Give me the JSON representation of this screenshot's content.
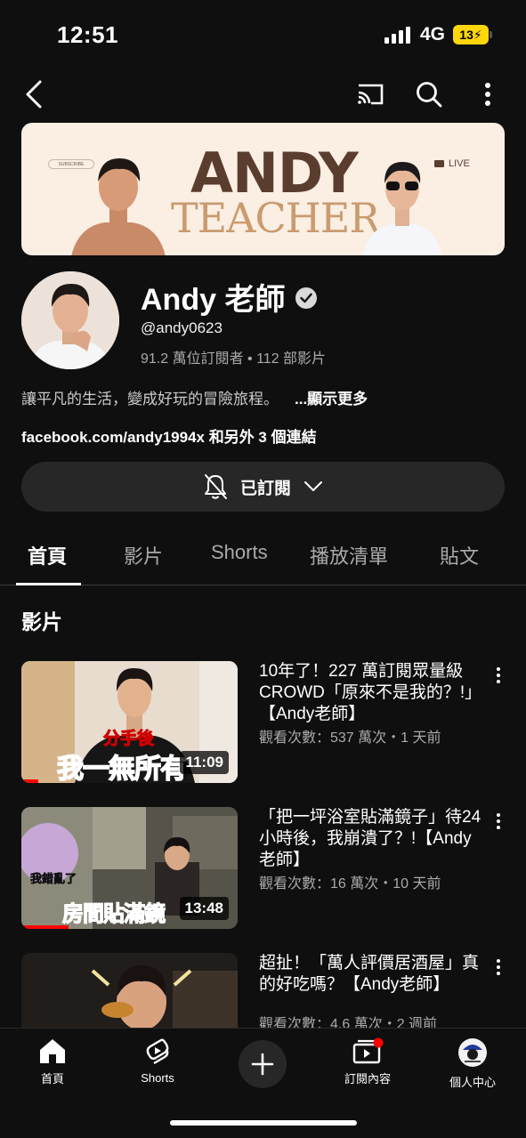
{
  "status_bar": {
    "time": "12:51",
    "network": "4G",
    "battery": "13"
  },
  "banner": {
    "title": "ANDY",
    "subtitle": "TEACHER",
    "live_label": "LIVE",
    "subscribe_label": "SUBSCRIBE"
  },
  "channel": {
    "name": "Andy 老師",
    "handle": "@andy0623",
    "stats": "91.2 萬位訂閱者 • 112 部影片",
    "description": "讓平凡的生活，變成好玩的冒險旅程。",
    "more_label": "...顯示更多",
    "links": "facebook.com/andy1994x 和另外 3 個連結",
    "subscribed_label": "已訂閱"
  },
  "tabs": [
    {
      "label": "首頁",
      "active": true
    },
    {
      "label": "影片",
      "active": false
    },
    {
      "label": "Shorts",
      "active": false
    },
    {
      "label": "播放清單",
      "active": false
    },
    {
      "label": "貼文",
      "active": false
    }
  ],
  "section_title": "影片",
  "videos": [
    {
      "title": "10年了！227 萬訂閱眾量級CROWD「原來不是我的？!」【Andy老師】",
      "meta": "觀看次數：537 萬次・1 天前",
      "duration": "11:09",
      "progress": 0.08,
      "thumb_caption_small": "分手後",
      "thumb_caption": "我一無所有"
    },
    {
      "title": "「把一坪浴室貼滿鏡子」待24小時後，我崩潰了？!【Andy老師】",
      "meta": "觀看次數：16 萬次・10 天前",
      "duration": "13:48",
      "progress": 0.22,
      "thumb_caption_small": "我錯亂了",
      "thumb_caption": "房間貼滿鏡"
    },
    {
      "title": "超扯！「萬人評價居酒屋」真的好吃嗎？【Andy老師】",
      "meta": "觀看次數：4.6 萬次・2 週前",
      "duration": "",
      "progress": 0,
      "thumb_caption_small": "",
      "thumb_caption": ""
    }
  ],
  "bottom_nav": [
    {
      "label": "首頁",
      "icon": "home-icon"
    },
    {
      "label": "Shorts",
      "icon": "shorts-icon"
    },
    {
      "label": "",
      "icon": "plus-icon"
    },
    {
      "label": "訂閱內容",
      "icon": "subscriptions-icon"
    },
    {
      "label": "個人中心",
      "icon": "account-avatar-icon"
    }
  ],
  "colors": {
    "background": "#0f0f0f",
    "accent": "#ff0000",
    "battery": "#ffd60a"
  }
}
